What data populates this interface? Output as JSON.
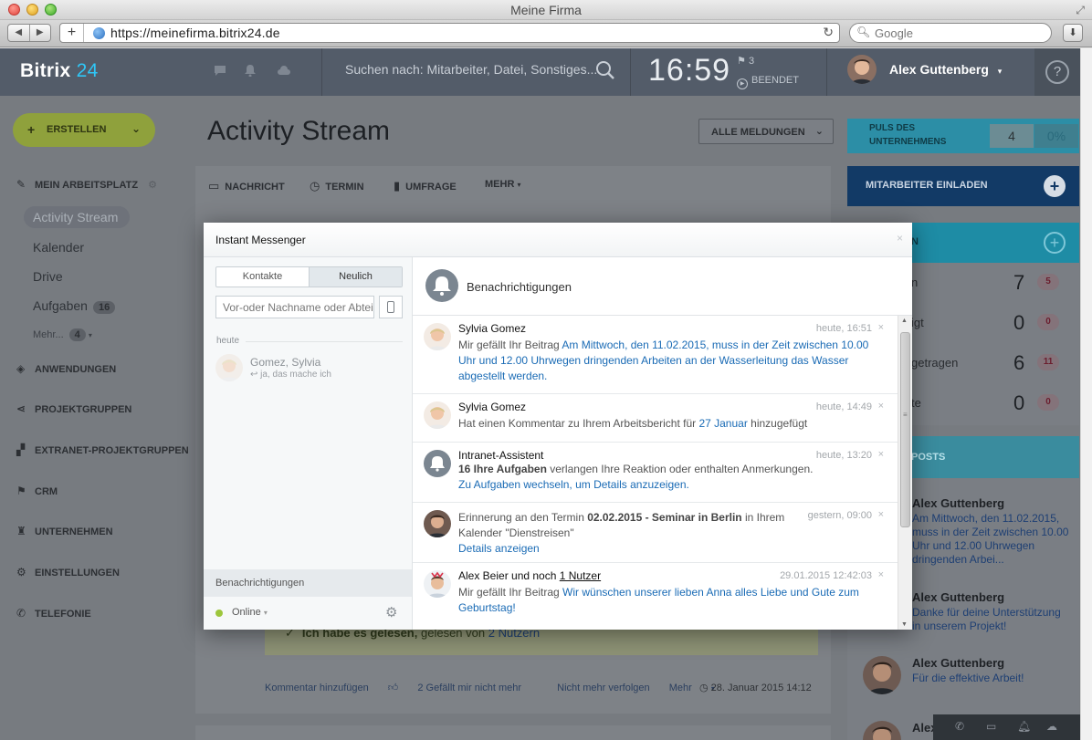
{
  "window": {
    "title": "Meine Firma"
  },
  "browser": {
    "url": "https://meinefirma.bitrix24.de",
    "search_placeholder": "Google"
  },
  "header": {
    "logo_name": "Bitrix",
    "logo_num": "24",
    "search_placeholder": "Suchen nach: Mitarbeiter, Datei, Sonstiges...",
    "clock": "16:59",
    "flag_count": "3",
    "status": "BEENDET",
    "user_name": "Alex Guttenberg",
    "help": "?"
  },
  "sidebar": {
    "create_label": "ERSTELLEN",
    "workplace": "MEIN ARBEITSPLATZ",
    "sub_items": [
      {
        "label": "Activity Stream"
      },
      {
        "label": "Kalender"
      },
      {
        "label": "Drive"
      },
      {
        "label": "Aufgaben",
        "count": "16"
      }
    ],
    "more_label": "Mehr...",
    "more_count": "4",
    "sections": [
      {
        "label": "ANWENDUNGEN",
        "icon": "apps-icon"
      },
      {
        "label": "PROJEKTGRUPPEN",
        "icon": "share-icon"
      },
      {
        "label": "EXTRANET-PROJEKTGRUPPEN",
        "icon": "extranet-icon"
      },
      {
        "label": "CRM",
        "icon": "flag-icon"
      },
      {
        "label": "UNTERNEHMEN",
        "icon": "castle-icon"
      },
      {
        "label": "EINSTELLUNGEN",
        "icon": "gear-icon"
      },
      {
        "label": "TELEFONIE",
        "icon": "phone-icon"
      }
    ]
  },
  "main": {
    "title": "Activity Stream",
    "filter_label": "ALLE MELDUNGEN",
    "tabs": [
      {
        "label": "NACHRICHT"
      },
      {
        "label": "TERMIN"
      },
      {
        "label": "UMFRAGE"
      },
      {
        "label": "MEHR"
      }
    ],
    "read_text": "Ich habe es gelesen,",
    "read_by": "gelesen von",
    "read_by_link": "2 Nutzern",
    "actions": {
      "comment": "Kommentar hinzufügen",
      "like": "2 Gefällt mir nicht mehr",
      "unfollow": "Nicht mehr verfolgen",
      "more": "Mehr"
    },
    "date": "28. Januar 2015 14:12"
  },
  "right": {
    "puls_label_1": "PULS DES",
    "puls_label_2": "UNTERNEHMENS",
    "puls_value": "4",
    "puls_percent": "0%",
    "invite_label": "MITARBEITER EINLADEN",
    "tasks_head": "N",
    "task_rows": [
      {
        "label": "n",
        "num": "7",
        "badge": "5"
      },
      {
        "label": "igt",
        "num": "0",
        "badge": "0"
      },
      {
        "label": "getragen",
        "num": "6",
        "badge": "11"
      },
      {
        "label": "te",
        "num": "0",
        "badge": "0"
      }
    ],
    "posts_head": "POSTS",
    "posts": [
      {
        "who": "Alex Guttenberg",
        "text": "Am Mittwoch, den 11.02.2015, muss in der Zeit zwischen 10.00 Uhr und 12.00 Uhrwegen dringenden Arbei..."
      },
      {
        "who": "Alex Guttenberg",
        "text": "Danke für deine Unterstützung in unserem Projekt!"
      },
      {
        "who": "Alex Guttenberg",
        "text": "Für die effektive Arbeit!"
      },
      {
        "who": "Alex",
        "text": ""
      }
    ]
  },
  "messenger": {
    "title": "Instant Messenger",
    "tab_contacts": "Kontakte",
    "tab_recent": "Neulich",
    "search_placeholder": "Vor-oder Nachname oder Abteilung",
    "day_label": "heute",
    "chat": {
      "name": "Gomez, Sylvia",
      "last": "ja, das mache ich"
    },
    "left_bottom_label": "Benachrichtigungen",
    "status": "Online",
    "notif_title": "Benachrichtigungen",
    "notifications": [
      {
        "who": "Sylvia Gomez",
        "time": "heute, 16:51",
        "pre": "Mir gefällt Ihr Beitrag ",
        "link": "Am Mittwoch, den 11.02.2015, muss in der Zeit zwischen 10.00 Uhr und 12.00 Uhrwegen dringenden Arbeiten an der Wasserleitung das Wasser abgestellt werden.",
        "post": ""
      },
      {
        "who": "Sylvia Gomez",
        "time": "heute, 14:49",
        "pre": "Hat einen Kommentar zu Ihrem Arbeitsbericht für ",
        "link": "27 Januar",
        "post": " hinzugefügt"
      },
      {
        "who": "Intranet-Assistent",
        "time": "heute, 13:20",
        "bold": "16 Ihre Aufgaben",
        "pre": " verlangen Ihre Reaktion oder enthalten Anmerkungen.",
        "link": "Zu Aufgaben wechseln, um Details anzuzeigen.",
        "post": ""
      },
      {
        "time": "gestern, 09:00",
        "pre": "Erinnerung an den Termin ",
        "bold": "02.02.2015 - Seminar in Berlin",
        "post": " in Ihrem Kalender \"Dienstreisen\"",
        "link": "Details anzeigen"
      },
      {
        "who": "Alex Beier und noch",
        "who_link": "1 Nutzer",
        "time": "29.01.2015 12:42:03",
        "pre": "Mir gefällt Ihr Beitrag ",
        "link": "Wir wünschen unserer lieben Anna alles Liebe und Gute zum Geburtstag!",
        "post": ""
      }
    ]
  },
  "colors": {
    "accent": "#2fc6f6",
    "link": "#1a6bb5",
    "online": "#9dc63c",
    "header": "#535c69"
  }
}
